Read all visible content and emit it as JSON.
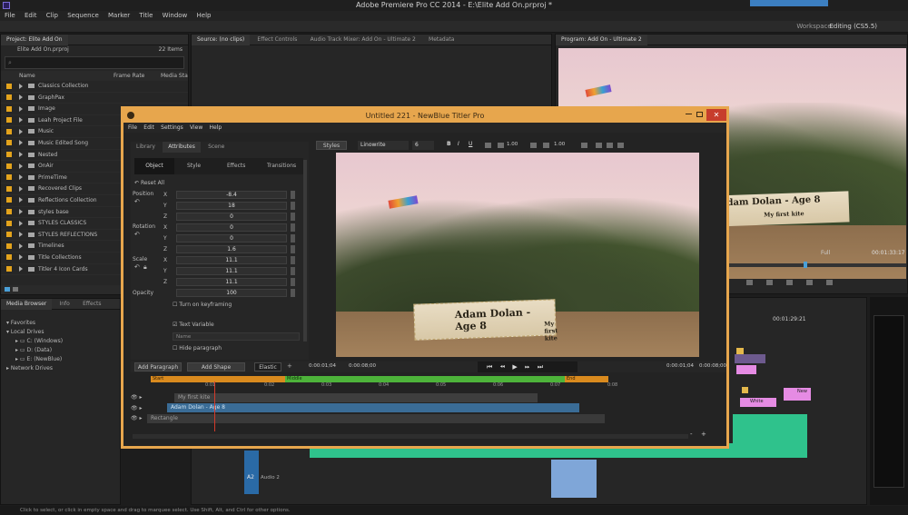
{
  "window": {
    "title": "Adobe Premiere Pro CC 2014 - E:\\Elite Add On.prproj *"
  },
  "menu": [
    "File",
    "Edit",
    "Clip",
    "Sequence",
    "Marker",
    "Title",
    "Window",
    "Help"
  ],
  "workspace": {
    "label": "Workspace:",
    "value": "Editing (CS5.5)"
  },
  "project_panel": {
    "tab": "Project: Elite Add On",
    "file": "Elite Add On.prproj",
    "items_count": "22 Items",
    "columns": [
      "Name",
      "Frame Rate",
      "Media Sta"
    ],
    "items": [
      "Classics Collection",
      "GraphPax",
      "Image",
      "Leah Project File",
      "Music",
      "Music Edited Song",
      "Nested",
      "OnAir",
      "PrimeTime",
      "Recovered Clips",
      "Reflections Collection",
      "styles base",
      "STYLES CLASSICS",
      "STYLES REFLECTIONS",
      "Timelines",
      "Title Collections",
      "Titler 4 Icon Cards"
    ]
  },
  "media_browser": {
    "tabs": [
      "Media Browser",
      "Info",
      "Effects"
    ],
    "favorites": "Favorites",
    "local_drives": "Local Drives",
    "drives": [
      "C: (Windows)",
      "D: (Data)",
      "E: (NewBlue)"
    ],
    "network": "Network Drives"
  },
  "source_panel": {
    "tabs": [
      "Source: (no clips)",
      "Effect Controls",
      "Audio Track Mixer: Add On - Ultimate 2",
      "Metadata"
    ]
  },
  "program_panel": {
    "tab": "Program: Add On - Ultimate 2",
    "lt_main": "Adam Dolan - Age 8",
    "lt_sub": "My first kite",
    "quality": "Full",
    "timecode": "00:01:33:17"
  },
  "timeline": {
    "ruler_time": "00:01:29:21",
    "track_a2": "A2",
    "track_a2_label": "Audio 2",
    "clip_label": "White",
    "clip_label2": "New"
  },
  "titler": {
    "title": "Untitled 221 - NewBlue Titler Pro",
    "menu": [
      "File",
      "Edit",
      "Settings",
      "View",
      "Help"
    ],
    "tabs": [
      "Library",
      "Attributes",
      "Scene"
    ],
    "subtabs": [
      "Object",
      "Style",
      "Effects",
      "Transitions"
    ],
    "reset": "Reset All",
    "position_label": "Position",
    "rotation_label": "Rotation",
    "scale_label": "Scale",
    "opacity_label": "Opacity",
    "position": {
      "x": "-8.4",
      "y": "18",
      "z": "0"
    },
    "rotation": {
      "x": "0",
      "y": "0",
      "z": "1.6"
    },
    "scale": {
      "x": "11.1",
      "y": "11.1",
      "z": "11.1"
    },
    "opacity": "100",
    "axes": [
      "X",
      "Y",
      "Z"
    ],
    "keyframing": "Turn on keyframing",
    "text_variable": "Text Variable",
    "name_placeholder": "Name",
    "hide_paragraph": "Hide paragraph",
    "toolbar": {
      "styles": "Styles",
      "font": "Linowrite",
      "size": "6",
      "bold": "B",
      "italic": "I",
      "underline": "U",
      "v1": "1.00",
      "v2": "1.00"
    },
    "preview": {
      "lt_main": "Adam Dolan - Age 8",
      "lt_sub": "My first kite"
    },
    "buttons": {
      "add_paragraph": "Add Paragraph",
      "add_shape": "Add Shape",
      "elastic": "Elastic",
      "plus": "+"
    },
    "timecodes": {
      "left1": "0:00:01;04",
      "left2": "0:00:08;00",
      "right1": "0:00:01;04",
      "right2": "0:00:08;00"
    },
    "segments": {
      "start": "Start",
      "middle": "Middle",
      "end": "End"
    },
    "ruler": [
      "0:01",
      "0:02",
      "0:03",
      "0:04",
      "0:05",
      "0:06",
      "0:07",
      "0:08"
    ],
    "tracks": [
      "My first kite",
      "Adam Dolan - Age 8",
      "Rectangle"
    ],
    "zoom": {
      "minus": "-",
      "plus": "+"
    }
  },
  "status_bar": "Click to select, or click in empty space and drag to marquee select. Use Shift, Alt, and Ctrl for other options.",
  "colors": {
    "accent": "#e7a64d",
    "close": "#c73d2c",
    "middle_green": "#4db33a",
    "segment_orange": "#d98a1e",
    "clip_pink": "#e58be3",
    "audio_green": "#2fc28c"
  }
}
